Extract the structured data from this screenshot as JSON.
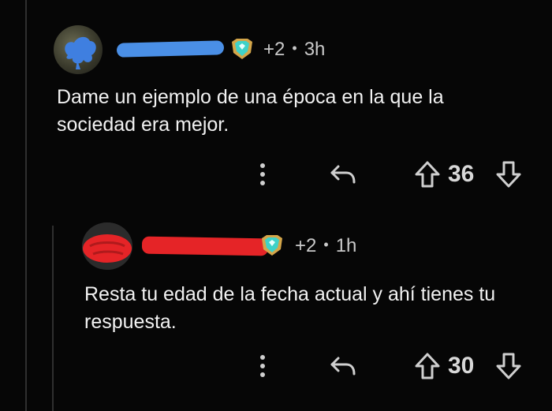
{
  "comments": [
    {
      "meta": "+2",
      "time": "3h",
      "text": "Dame un ejemplo de una época en la que la sociedad era mejor.",
      "score": "36",
      "username_mask_color": "#4a8fe6"
    },
    {
      "meta": "+2",
      "time": "1h",
      "text": "Resta tu edad de la fecha actual y ahí tienes tu respuesta.",
      "score": "30",
      "username_mask_color": "#e52427"
    }
  ],
  "icons": [
    "more-vertical-icon",
    "reply-icon",
    "upvote-icon",
    "downvote-icon",
    "award-badge-icon"
  ],
  "colors": {
    "background": "#060606",
    "text": "#f2f2f2",
    "muted": "#c9c9c9",
    "badge_teal": "#3fd2c9",
    "badge_gold": "#d4a64a"
  }
}
